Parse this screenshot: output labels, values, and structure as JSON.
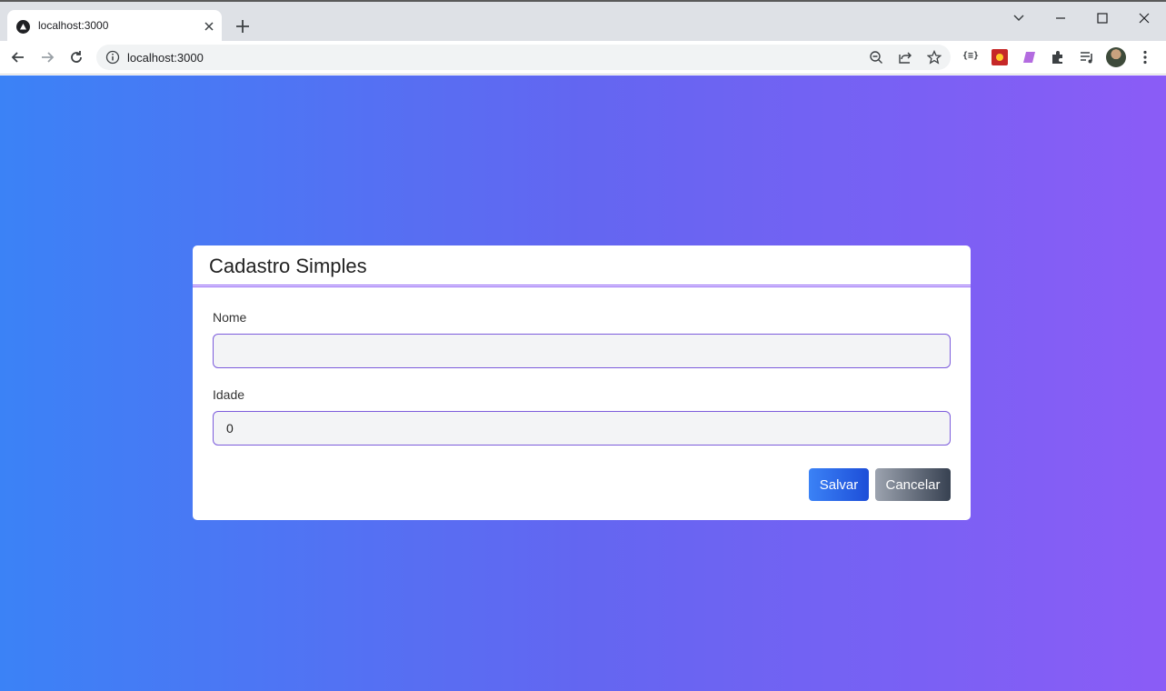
{
  "browser": {
    "tab_title": "localhost:3000",
    "url": "localhost:3000"
  },
  "form": {
    "title": "Cadastro Simples",
    "nome_label": "Nome",
    "nome_value": "",
    "idade_label": "Idade",
    "idade_value": "0",
    "save_label": "Salvar",
    "cancel_label": "Cancelar"
  },
  "colors": {
    "gradient_start": "#3b82f6",
    "gradient_end": "#8b5cf6",
    "accent_border": "#7c5cdc"
  }
}
